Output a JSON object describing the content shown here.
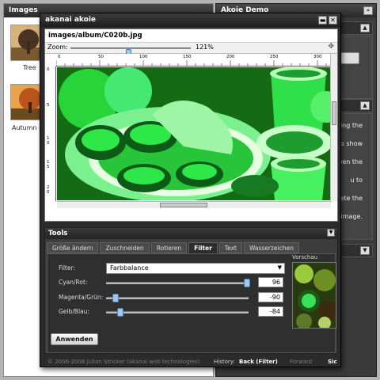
{
  "images_panel": {
    "title": "Images",
    "thumbs": [
      {
        "label": "Tree"
      },
      {
        "label": "Autumn L"
      }
    ]
  },
  "demo_panel": {
    "title": "Akoie Demo",
    "collapse_icon": "double-chevron-right-icon",
    "side_texts": [
      "ing the",
      "to show",
      "pen the",
      "u to",
      "elete the",
      "e image."
    ]
  },
  "dialog": {
    "title": "akanai akoie",
    "minimize_icon": "minimize-icon",
    "close_icon": "close-icon",
    "path": "images/album/C020b.jpg",
    "zoom_label": "Zoom:",
    "zoom_value": "121%",
    "zoom_level": 0.3,
    "ruler_top": [
      "0",
      "50",
      "100",
      "150",
      "200",
      "250",
      "300",
      "350"
    ],
    "ruler_left": [
      "0",
      "5",
      "1\n0",
      "1\n5",
      "2\n0"
    ]
  },
  "tools": {
    "title": "Tools",
    "tabs": [
      {
        "label": "Größe ändern",
        "active": false
      },
      {
        "label": "Zuschneiden",
        "active": false
      },
      {
        "label": "Rotieren",
        "active": false
      },
      {
        "label": "Filter",
        "active": true
      },
      {
        "label": "Text",
        "active": false
      },
      {
        "label": "Wasserzeichen",
        "active": false
      }
    ],
    "filter_label": "Filter:",
    "filter_value": "Farbbalance",
    "sliders": [
      {
        "label": "Cyan/Rot:",
        "value": "96",
        "fraction": 0.98
      },
      {
        "label": "Magenta/Grün:",
        "value": "-90",
        "fraction": 0.05
      },
      {
        "label": "Gelb/Blau:",
        "value": "-84",
        "fraction": 0.08
      }
    ],
    "preview_label": "Vorschau",
    "apply_label": "Anwenden"
  },
  "footer": {
    "copyright": "© 2006-2008 Julian Stricker (akanai web technologies)",
    "history_label": "History:",
    "back_label": "Back (Filter)",
    "forward_label": "Forward",
    "save_label": "Sic"
  },
  "colors": {
    "accent": "#9fc7ee",
    "filter_green": "#22d83a"
  }
}
